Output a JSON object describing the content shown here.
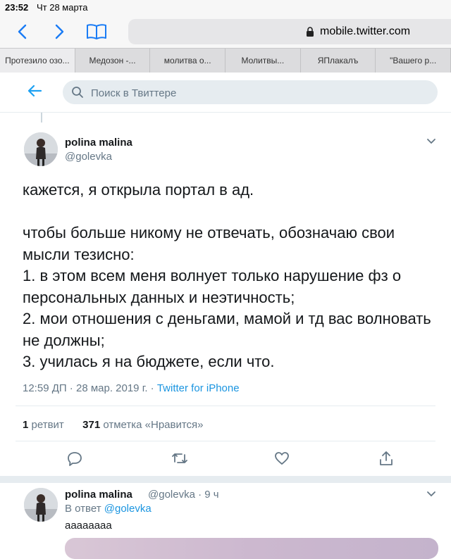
{
  "status_bar": {
    "time": "23:52",
    "date": "Чт 28 марта"
  },
  "browser": {
    "url": "mobile.twitter.com"
  },
  "tabs": [
    {
      "label": "Протезило озо..."
    },
    {
      "label": "Медозон -..."
    },
    {
      "label": "молитва о..."
    },
    {
      "label": "Молитвы..."
    },
    {
      "label": "ЯПлакалъ"
    },
    {
      "label": "\"Вашего р..."
    }
  ],
  "search": {
    "placeholder": "Поиск в Твиттере"
  },
  "tweet": {
    "name": "polina malina",
    "handle": "@golevka",
    "text": "кажется, я открыла портал в ад.\n\nчтобы больше никому не отвечать, обозначаю свои мысли тезисно:\n1. в этом всем меня волнует только нарушение фз о персональных данных и неэтичность;\n2. мои отношения с деньгами, мамой и тд вас волновать не должны;\n3. училась я на бюджете, если что.",
    "time": "12:59 ДП · 28 мар. 2019 г. · ",
    "source": "Twitter for iPhone",
    "retweets": "1",
    "retweets_label": " ретвит",
    "likes": "371",
    "likes_label": " отметка «Нравится»"
  },
  "reply": {
    "name": "polina malina",
    "handle_time": "@golevka · 9 ч",
    "reply_to_prefix": "В ответ ",
    "reply_to_handle": "@golevka",
    "text": "аааааааа"
  },
  "colors": {
    "accent": "#1b95e0",
    "muted": "#657786",
    "text": "#14171a"
  },
  "icons": [
    "back-icon",
    "forward-icon",
    "bookmarks-icon",
    "lock-icon",
    "search-icon",
    "chevron-down-icon",
    "reply-icon",
    "retweet-icon",
    "like-icon",
    "share-icon"
  ]
}
